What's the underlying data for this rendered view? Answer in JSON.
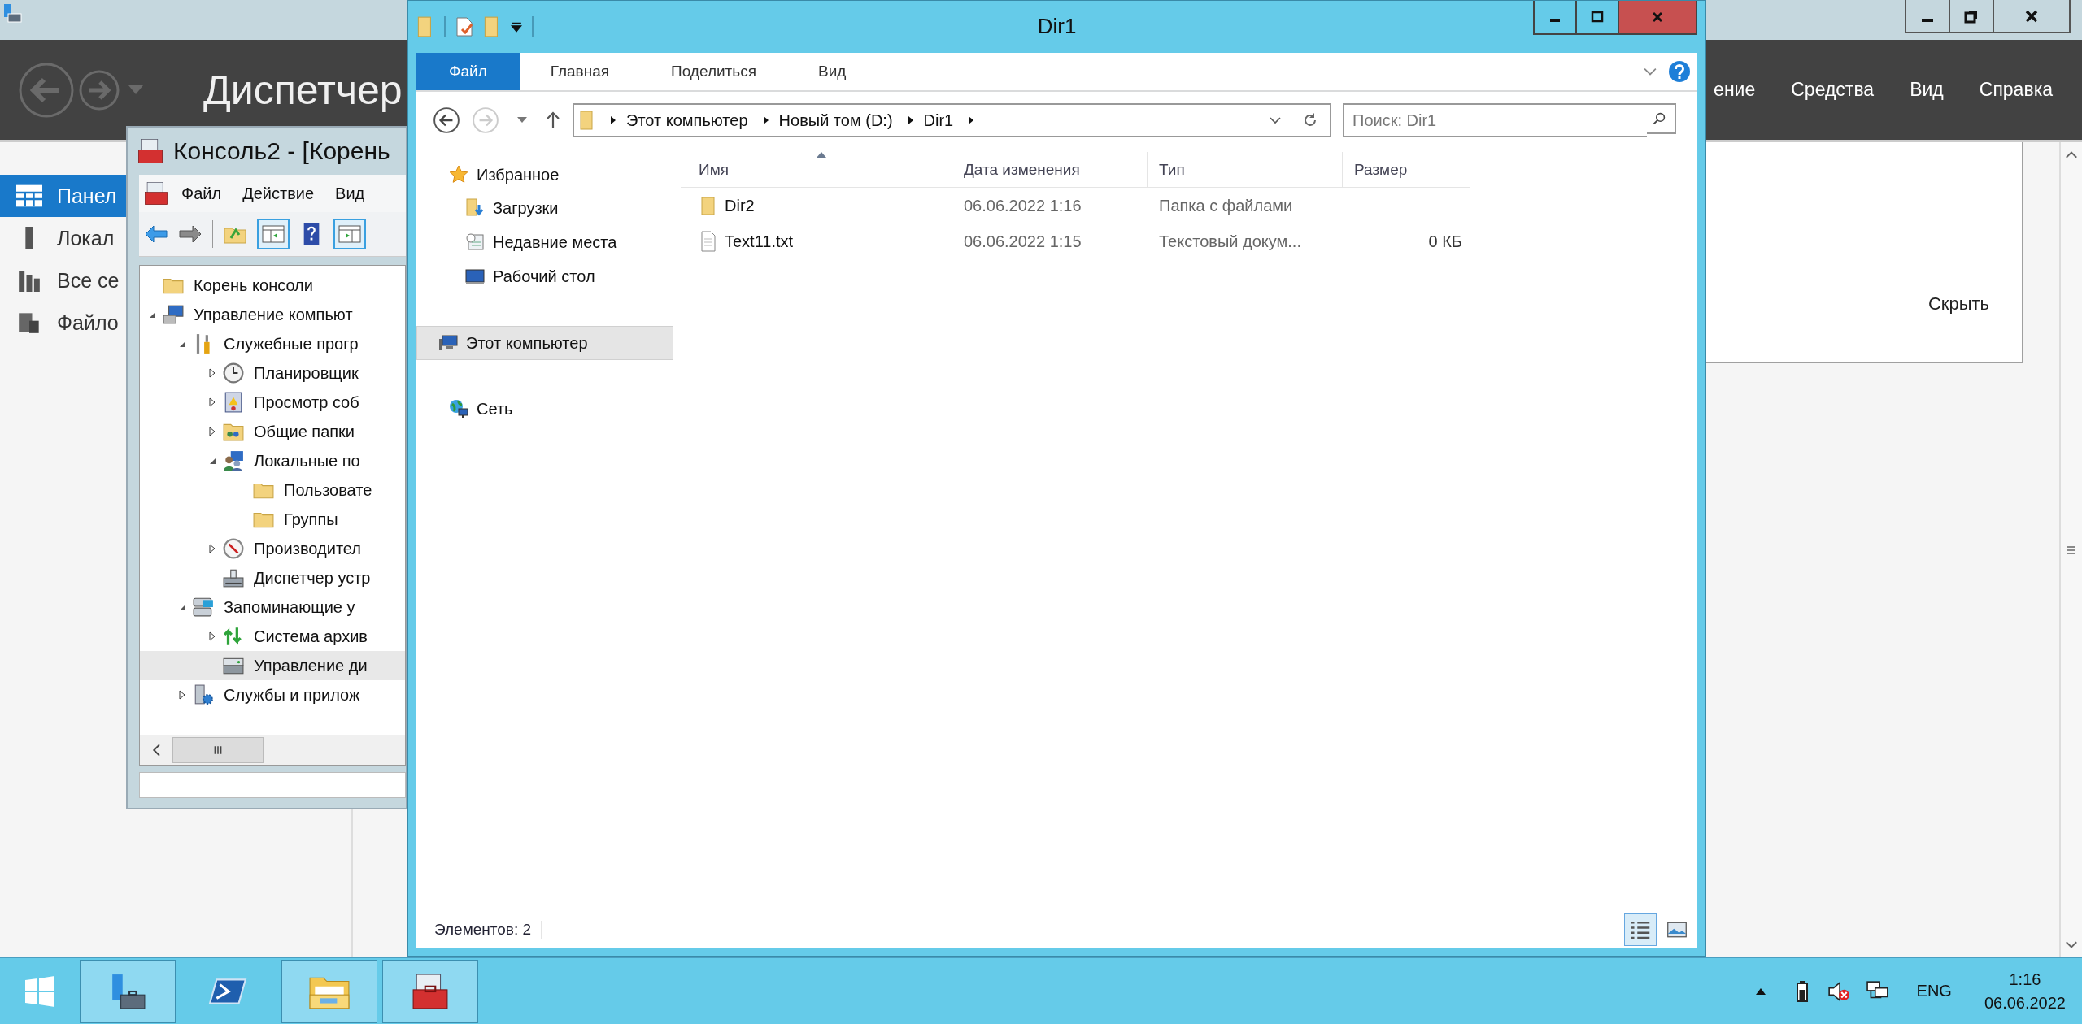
{
  "server_manager": {
    "title": "Диспетчер",
    "menu": [
      "ение",
      "Средства",
      "Вид",
      "Справка"
    ],
    "sidebar": [
      {
        "label": "Панел",
        "kind": "dashboard",
        "selected": true
      },
      {
        "label": "Локал",
        "kind": "server",
        "selected": false
      },
      {
        "label": "Все се",
        "kind": "servers",
        "selected": false
      },
      {
        "label": "Файло",
        "kind": "files",
        "selected": false
      }
    ],
    "panel": {
      "hide_link": "Скрыть"
    }
  },
  "console_window": {
    "title": "Консоль2 - [Корень",
    "menu": [
      "Файл",
      "Действие",
      "Вид"
    ],
    "tree": [
      {
        "label": "Корень консоли",
        "kind": "folder",
        "selected": false,
        "children": [
          {
            "label": "Управление компьют",
            "kind": "computer",
            "expanded": true,
            "selected": false,
            "children": [
              {
                "label": "Служебные прогр",
                "kind": "tools",
                "expanded": true,
                "selected": false,
                "children": [
                  {
                    "label": "Планировщик",
                    "kind": "clock",
                    "expanded": false,
                    "selected": false
                  },
                  {
                    "label": "Просмотр соб",
                    "kind": "log",
                    "expanded": false,
                    "selected": false
                  },
                  {
                    "label": "Общие папки",
                    "kind": "shared",
                    "expanded": false,
                    "selected": false
                  },
                  {
                    "label": "Локальные по",
                    "kind": "users",
                    "expanded": true,
                    "selected": false,
                    "children": [
                      {
                        "label": "Пользовате",
                        "kind": "folder",
                        "selected": false
                      },
                      {
                        "label": "Группы",
                        "kind": "folder",
                        "selected": false
                      }
                    ]
                  },
                  {
                    "label": "Производител",
                    "kind": "perf",
                    "expanded": false,
                    "selected": false
                  },
                  {
                    "label": "Диспетчер устр",
                    "kind": "device",
                    "selected": false
                  }
                ]
              },
              {
                "label": "Запоминающие у",
                "kind": "storage",
                "expanded": true,
                "selected": false,
                "children": [
                  {
                    "label": "Система архив",
                    "kind": "backup",
                    "expanded": false,
                    "selected": false
                  },
                  {
                    "label": "Управление ди",
                    "kind": "disk",
                    "selected": true
                  }
                ]
              },
              {
                "label": "Службы и прилож",
                "kind": "services",
                "expanded": false,
                "selected": false
              }
            ]
          }
        ]
      }
    ]
  },
  "explorer_window": {
    "title": "Dir1",
    "ribbon_tabs": [
      {
        "label": "Файл",
        "selected": true
      },
      {
        "label": "Главная",
        "selected": false
      },
      {
        "label": "Поделиться",
        "selected": false
      },
      {
        "label": "Вид",
        "selected": false
      }
    ],
    "address": [
      "Этот компьютер",
      "Новый том (D:)",
      "Dir1"
    ],
    "search": {
      "placeholder": "Поиск: Dir1"
    },
    "nav": [
      {
        "label": "Избранное",
        "kind": "star",
        "selected": false,
        "children": [
          {
            "label": "Загрузки",
            "kind": "downloads",
            "selected": false
          },
          {
            "label": "Недавние места",
            "kind": "recent",
            "selected": false
          },
          {
            "label": "Рабочий стол",
            "kind": "desktop",
            "selected": false
          }
        ]
      },
      {
        "label": "Этот компьютер",
        "kind": "computer",
        "selected": true
      },
      {
        "label": "Сеть",
        "kind": "network",
        "selected": false
      }
    ],
    "columns": [
      "Имя",
      "Дата изменения",
      "Тип",
      "Размер"
    ],
    "rows": [
      {
        "kind": "folder",
        "name": "Dir2",
        "date": "06.06.2022 1:16",
        "type": "Папка с файлами"
      },
      {
        "kind": "text",
        "name": "Text11.txt",
        "date": "06.06.2022 1:15",
        "type": "Текстовый докум...",
        "size": "0 КБ"
      }
    ],
    "status": "Элементов: 2"
  },
  "taskbar": {
    "apps": [
      {
        "kind": "server-manager",
        "running": true
      },
      {
        "kind": "powershell",
        "running": false
      },
      {
        "kind": "explorer",
        "running": true
      },
      {
        "kind": "toolbox",
        "running": true
      }
    ],
    "language": "ENG",
    "time": "1:16",
    "date": "06.06.2022"
  }
}
